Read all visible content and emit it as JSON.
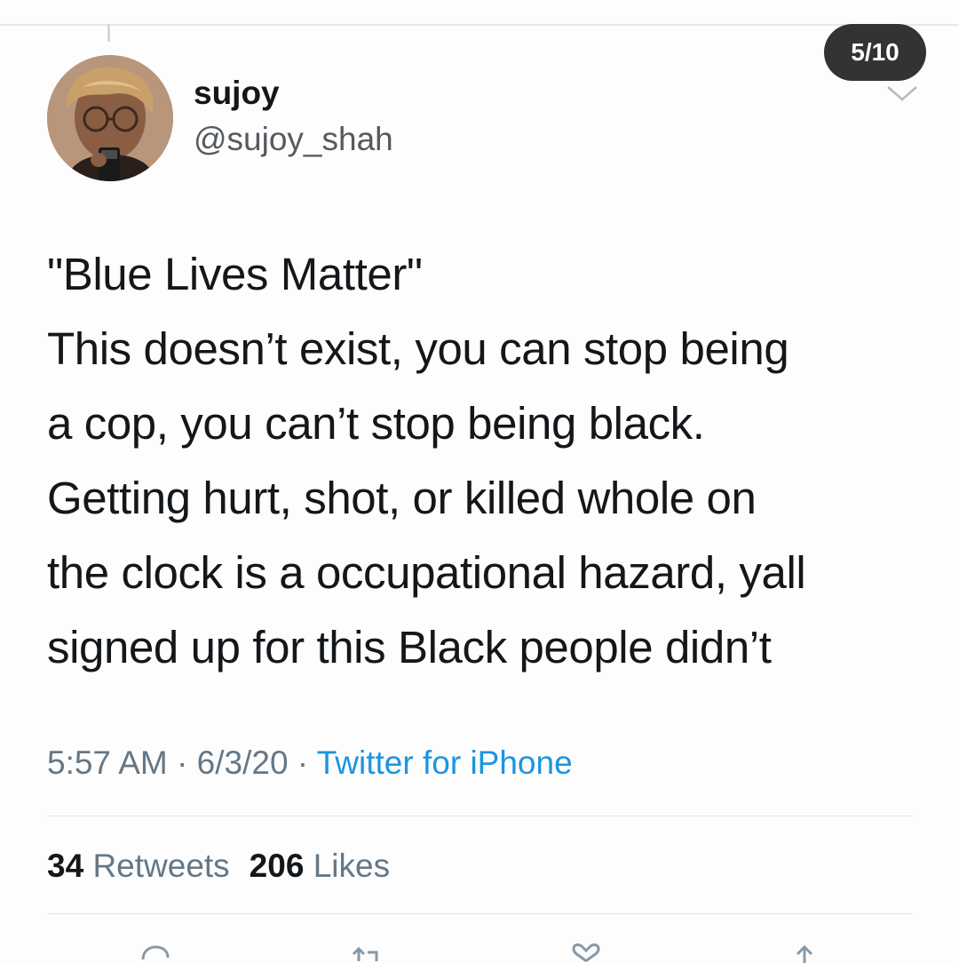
{
  "badge": {
    "label": "5/10"
  },
  "author": {
    "display_name": "sujoy",
    "handle": "@sujoy_shah"
  },
  "tweet": {
    "lines": [
      "\"Blue Lives Matter\"",
      "This doesn’t exist, you can stop being",
      "a cop, you can’t stop being black.",
      "Getting hurt, shot, or killed whole on",
      "the clock is a occupational hazard, yall",
      "signed up for this Black people didn’t"
    ],
    "time": "5:57 AM",
    "separator": " · ",
    "date": "6/3/20",
    "source": "Twitter for iPhone"
  },
  "stats": {
    "retweets_count": "34",
    "retweets_label": "Retweets",
    "likes_count": "206",
    "likes_label": "Likes"
  },
  "icons": {
    "chevron": "chevron-down-icon",
    "reply": "reply-icon",
    "retweet": "retweet-icon",
    "like": "heart-icon",
    "share": "share-icon"
  }
}
